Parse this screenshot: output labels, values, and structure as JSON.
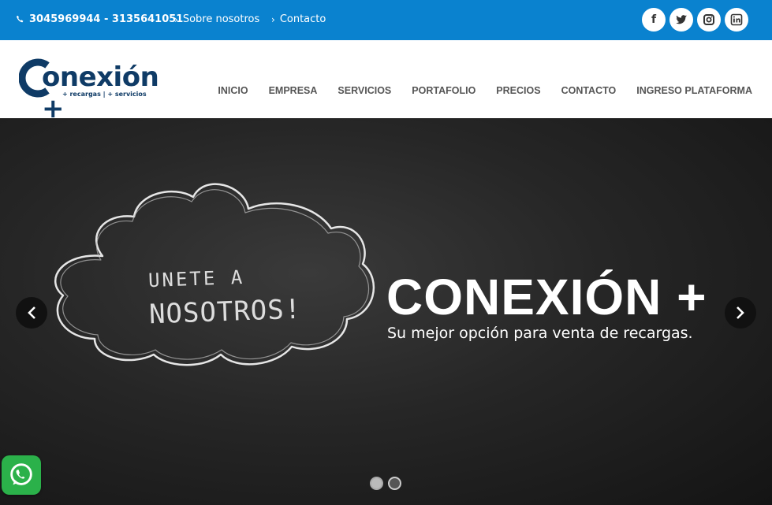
{
  "topbar": {
    "phone": "3045969944 - 3135641051",
    "links": [
      {
        "label": "Sobre nosotros"
      },
      {
        "label": "Contacto"
      }
    ],
    "social": [
      {
        "icon": "facebook-icon",
        "glyph": "f"
      },
      {
        "icon": "twitter-icon"
      },
      {
        "icon": "instagram-icon"
      },
      {
        "icon": "linkedin-icon"
      }
    ]
  },
  "logo": {
    "word": "onexión +",
    "sub": "+ recargas | + servicios"
  },
  "nav": {
    "items": [
      "INICIO",
      "EMPRESA",
      "SERVICIOS",
      "PORTAFOLIO",
      "PRECIOS",
      "CONTACTO",
      "INGRESO PLATAFORMA"
    ]
  },
  "hero": {
    "cloud_line1": "UNETE A",
    "cloud_line2": "NOSOTROS!",
    "title": "CONEXIÓN +",
    "subtitle": "Su mejor opción para venta de recargas.",
    "slides": 2,
    "active_slide": 2
  },
  "colors": {
    "topbar": "#0a82cf",
    "brand": "#0f3b66",
    "whatsapp": "#2bb14a"
  }
}
